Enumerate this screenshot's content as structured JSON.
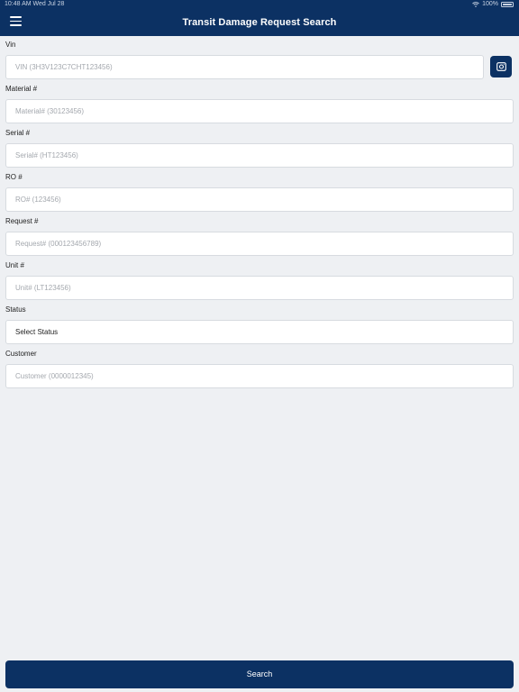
{
  "status_bar": {
    "time": "10:48 AM   Wed Jul 28",
    "battery": "100%"
  },
  "header": {
    "title": "Transit Damage Request Search",
    "menu_icon": "hamburger-menu-icon"
  },
  "form": {
    "vin": {
      "label": "Vin",
      "placeholder": "VIN (3H3V123C7CHT123456)"
    },
    "material": {
      "label": "Material #",
      "placeholder": "Material# (30123456)"
    },
    "serial": {
      "label": "Serial #",
      "placeholder": "Serial# (HT123456)"
    },
    "ro": {
      "label": "RO #",
      "placeholder": "RO# (123456)"
    },
    "request": {
      "label": "Request #",
      "placeholder": "Request# (000123456789)"
    },
    "unit": {
      "label": "Unit #",
      "placeholder": "Unit# (LT123456)"
    },
    "status": {
      "label": "Status",
      "value": "Select Status"
    },
    "customer": {
      "label": "Customer",
      "placeholder": "Customer (0000012345)"
    }
  },
  "camera_button": {
    "icon": "camera-icon"
  },
  "search_button": {
    "label": "Search"
  },
  "colors": {
    "brand": "#0c3163",
    "background": "#eef0f3",
    "input_background": "#ffffff"
  }
}
